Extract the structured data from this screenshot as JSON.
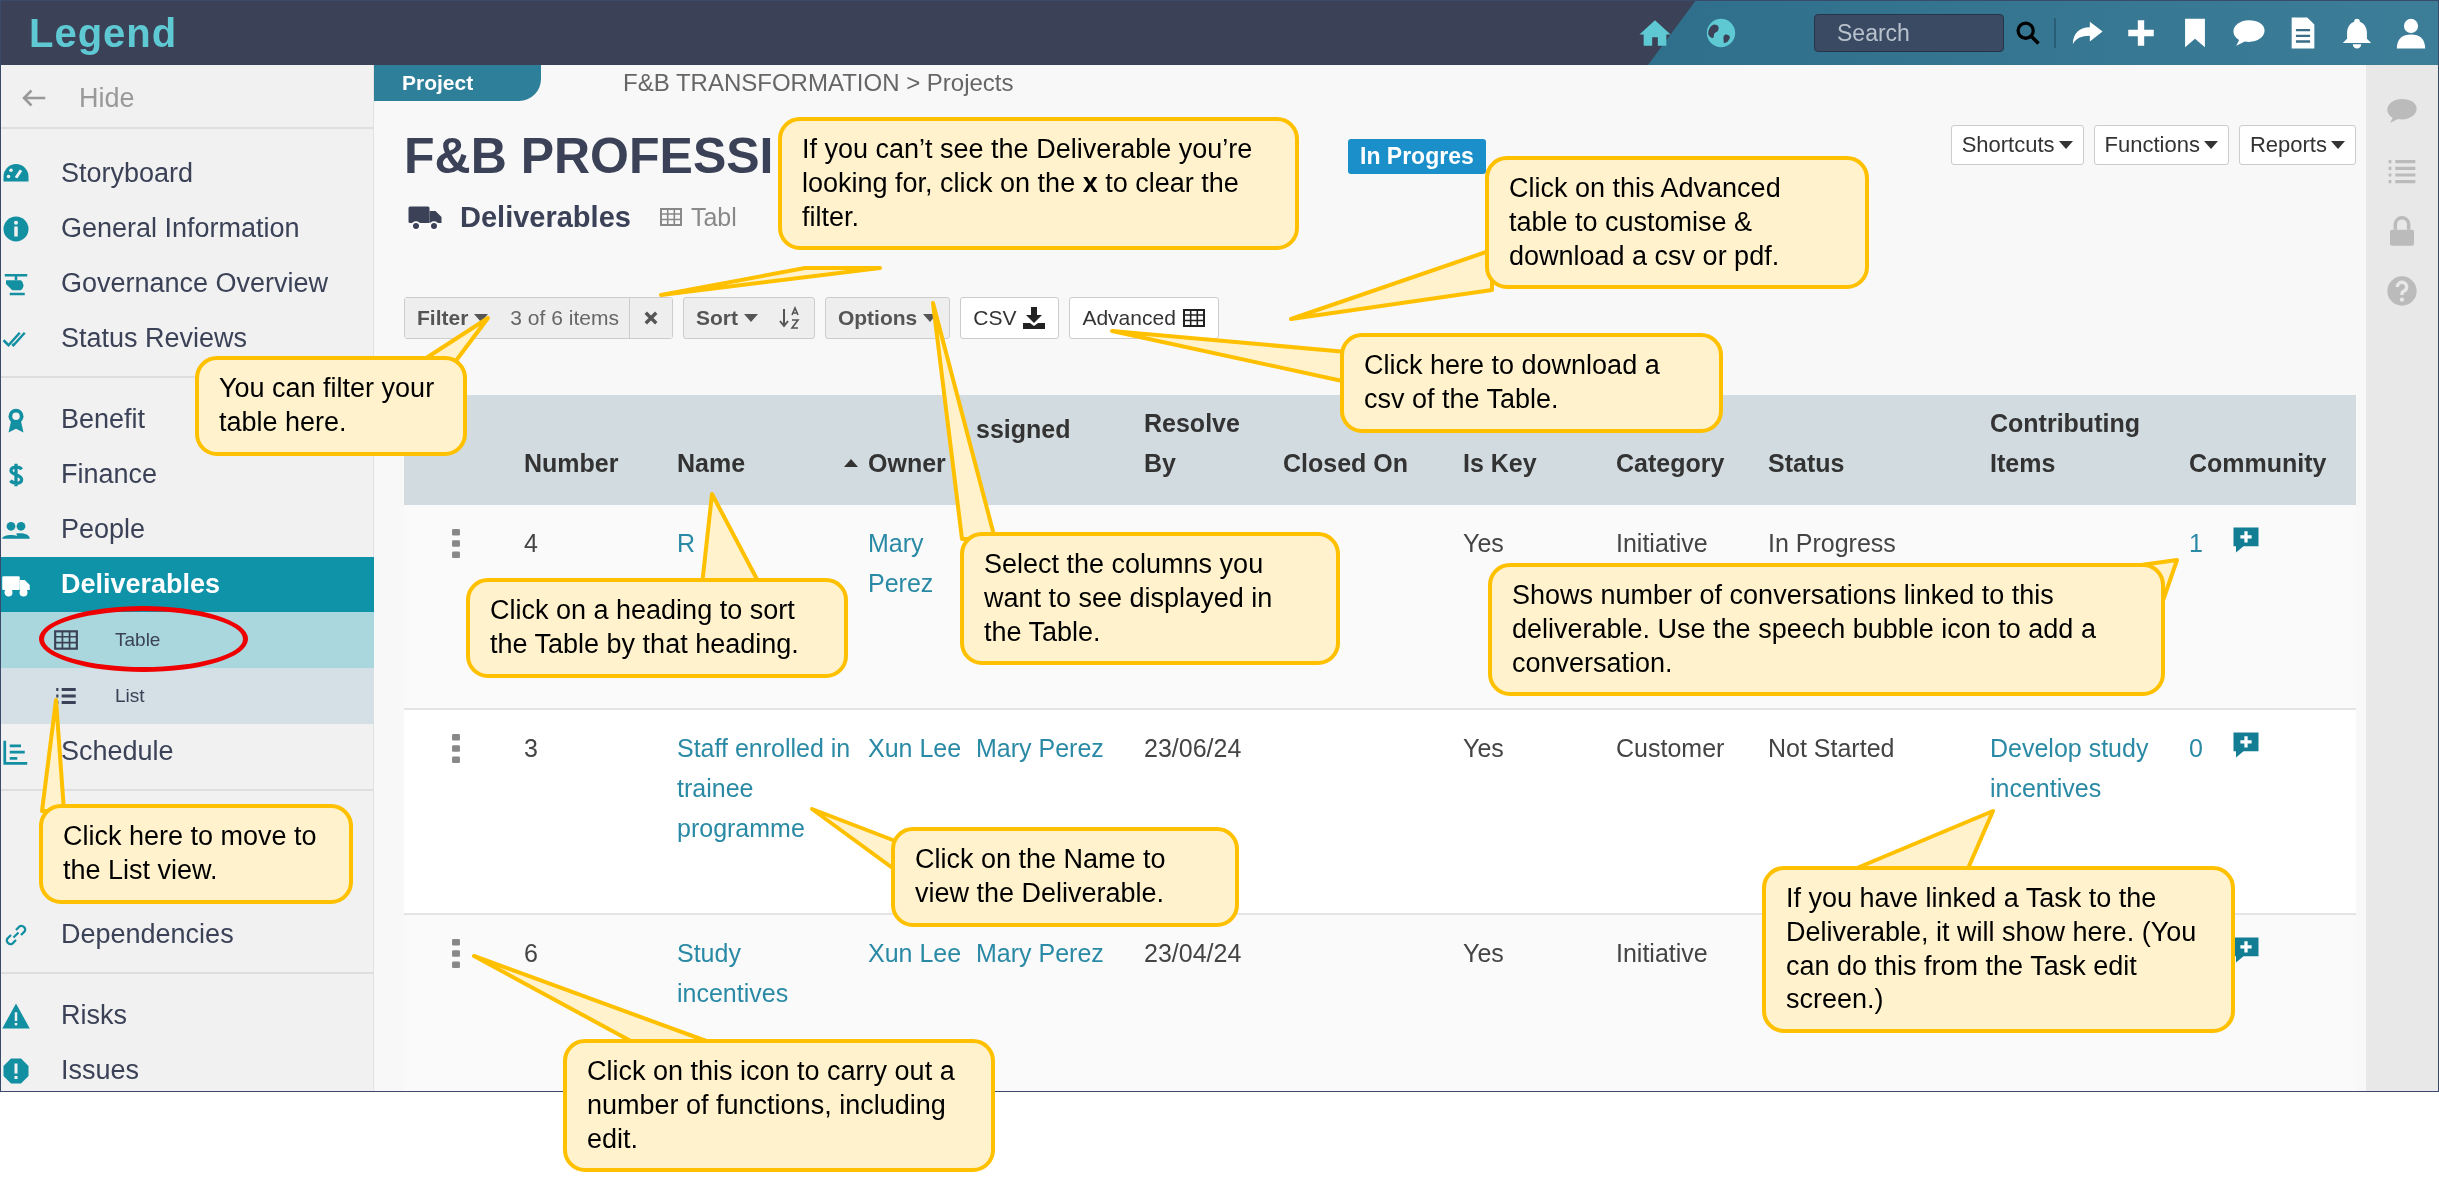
{
  "top_bar": {
    "logo": "Legend",
    "search": {
      "placeholder": "Search"
    }
  },
  "sidebar": {
    "hide": "Hide",
    "groups": [
      [
        {
          "label": "Storyboard",
          "selected": false
        },
        {
          "label": "General Information",
          "selected": false
        },
        {
          "label": "Governance Overview",
          "selected": false
        },
        {
          "label": "Status Reviews",
          "selected": false
        }
      ],
      [
        {
          "label": "Benefit",
          "selected": false
        },
        {
          "label": "Finance",
          "selected": false
        },
        {
          "label": "People",
          "selected": false
        },
        {
          "label": "Deliverables",
          "selected": true,
          "children": [
            {
              "label": "Table",
              "selected": true
            },
            {
              "label": "List",
              "selected": false
            }
          ]
        },
        {
          "label": "Schedule",
          "selected": false
        }
      ],
      [
        {
          "label": "Dependencies",
          "selected": false
        }
      ],
      [
        {
          "label": "Risks",
          "selected": false
        },
        {
          "label": "Issues",
          "selected": false
        }
      ]
    ]
  },
  "breadcrumb": {
    "section_tab": "Project",
    "path": "F&B TRANSFORMATION > Projects"
  },
  "page": {
    "title": "F&B PROFESSI",
    "status_badge": "In Progres",
    "menus": [
      "Shortcuts",
      "Functions",
      "Reports"
    ],
    "module": "Deliverables",
    "view_tab": "Tabl"
  },
  "toolbar": {
    "filter": "Filter",
    "filter_count": "3 of 6 items",
    "sort": "Sort",
    "options": "Options",
    "csv": "CSV",
    "advanced": "Advanced"
  },
  "table": {
    "columns": [
      {
        "label": "Number",
        "sorted": false
      },
      {
        "label": "Name",
        "sorted": true
      },
      {
        "label": "Owner",
        "sorted": false
      },
      {
        "label": "ssigned",
        "sorted": false
      },
      {
        "label": "Resolve By",
        "sorted": false
      },
      {
        "label": "Closed On",
        "sorted": false
      },
      {
        "label": "Is Key",
        "sorted": false
      },
      {
        "label": "Category",
        "sorted": false
      },
      {
        "label": "Status",
        "sorted": false
      },
      {
        "label": "Contributing Items",
        "sorted": false
      },
      {
        "label": "Community",
        "sorted": false
      }
    ],
    "rows": [
      {
        "number": "4",
        "name": "R",
        "owner": "Mary Perez",
        "is_key": "Yes",
        "category": "Initiative",
        "status": "In Progress",
        "community": "1"
      },
      {
        "number": "3",
        "name": "Staff enrolled in trainee programme",
        "owner": "Xun Lee",
        "assigned": "Mary Perez",
        "resolve_by": "23/06/24",
        "is_key": "Yes",
        "category": "Customer",
        "status": "Not Started",
        "contributing_items": "Develop study incentives",
        "community": "0"
      },
      {
        "number": "6",
        "name": "Study incentives",
        "owner": "Xun Lee",
        "assigned": "Mary Perez",
        "resolve_by": "23/04/24",
        "is_key": "Yes",
        "category": "Initiative"
      }
    ]
  },
  "callouts": [
    {
      "text": "If you can’t see the Deliverable you’re looking for, click on the **x** to clear the filter."
    },
    {
      "text": "You can filter your table here."
    },
    {
      "text": "Click on this Advanced table  to customise & download a csv or pdf."
    },
    {
      "text": "Click here to download a csv of the Table."
    },
    {
      "text": "Click on a heading to sort the Table by that heading."
    },
    {
      "text": "Select the columns you want to see displayed in the Table."
    },
    {
      "text": "Shows number of conversations linked to this deliverable.  Use the speech bubble icon to add a conversation."
    },
    {
      "text": "Click here to move to the List view."
    },
    {
      "text": "Click on the Name to view the Deliverable."
    },
    {
      "text": "If you have linked a Task to the Deliverable, it will show here.  (You can do this from the Task edit screen.)"
    },
    {
      "text": "Click on this icon to carry out a number of functions, including edit."
    }
  ]
}
